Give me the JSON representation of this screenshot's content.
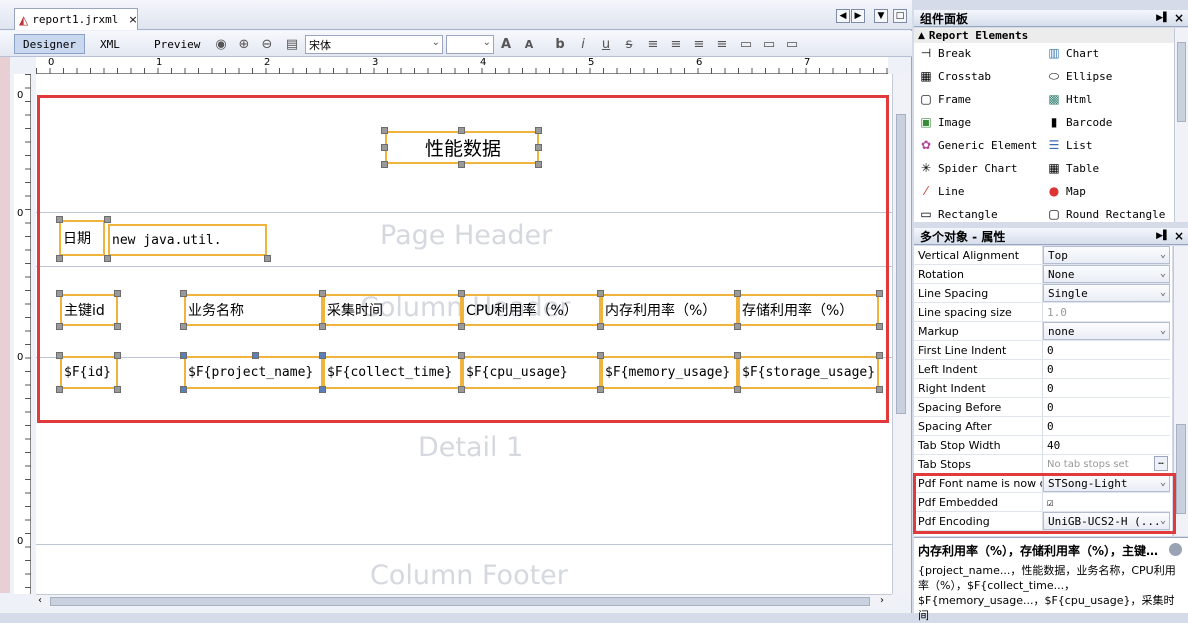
{
  "editor": {
    "file_tab": "report1.jrxml",
    "close": "×",
    "modes": [
      "Designer",
      "XML",
      "Preview"
    ],
    "font_name": "宋体",
    "font_size": ""
  },
  "ruler": {
    "h_marks": [
      "0",
      "1",
      "2",
      "3",
      "4",
      "5",
      "6",
      "7"
    ],
    "v_marks": [
      "0",
      "0",
      "0",
      "0",
      "0"
    ]
  },
  "bands": {
    "page_header": "Page Header",
    "column_header": "Column Header",
    "detail": "Detail 1",
    "column_footer": "Column Footer"
  },
  "report": {
    "title": "性能数据",
    "date_label": "日期",
    "date_expr": "new java.util.",
    "headers": [
      "主键id",
      "业务名称",
      "采集时间",
      "CPU利用率（%）",
      "内存利用率（%）",
      "存储利用率（%）"
    ],
    "fields": [
      "$F{id}",
      "$F{project_name}",
      "$F{collect_time}",
      "$F{cpu_usage}",
      "$F{memory_usage}",
      "$F{storage_usage}"
    ]
  },
  "palette": {
    "title": "组件面板",
    "section": "Report Elements",
    "items_left": [
      "Break",
      "Crosstab",
      "Frame",
      "Image",
      "Generic Element",
      "Spider Chart",
      "Line",
      "Rectangle"
    ],
    "items_right": [
      "Chart",
      "Ellipse",
      "Html",
      "Barcode",
      "List",
      "Table",
      "Map",
      "Round Rectangle"
    ]
  },
  "properties": {
    "title": "多个对象 - 属性",
    "rows": [
      {
        "name": "Vertical Alignment",
        "value": "Top",
        "dropdown": true
      },
      {
        "name": "Rotation",
        "value": "None",
        "dropdown": true
      },
      {
        "name": "Line Spacing",
        "value": "Single",
        "dropdown": true
      },
      {
        "name": "Line spacing size",
        "value": "1.0",
        "dropdown": false
      },
      {
        "name": "Markup",
        "value": "none",
        "dropdown": true
      },
      {
        "name": "First Line Indent",
        "value": "0",
        "dropdown": false
      },
      {
        "name": "Left Indent",
        "value": "0",
        "dropdown": false
      },
      {
        "name": "Right Indent",
        "value": "0",
        "dropdown": false
      },
      {
        "name": "Spacing Before",
        "value": "0",
        "dropdown": false
      },
      {
        "name": "Spacing After",
        "value": "0",
        "dropdown": false
      },
      {
        "name": "Tab Stop Width",
        "value": "40",
        "dropdown": false
      },
      {
        "name": "Tab Stops",
        "value": "No tab stops set",
        "dropdown": false
      },
      {
        "name": "Pdf Font name is now dep",
        "value": "STSong-Light",
        "dropdown": true
      },
      {
        "name": "Pdf Embedded",
        "value": "☑",
        "dropdown": false
      },
      {
        "name": "Pdf Encoding",
        "value": "UniGB-UCS2-H (...",
        "dropdown": true
      }
    ],
    "description_title": "内存利用率（%），存储利用率（%），主键…",
    "description_body": "{project_name...，性能数据，业务名称，CPU利用率（%），$F{collect_time...，$F{memory_usage...，$F{cpu_usage}，采集时间"
  }
}
